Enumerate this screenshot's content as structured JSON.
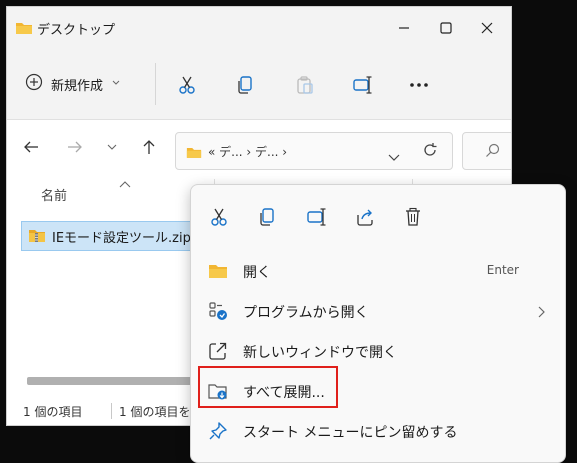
{
  "window": {
    "title": "デスクトップ"
  },
  "toolbar": {
    "new_label": "新規作成"
  },
  "nav": {
    "breadcrumb": "«  デ...  ›  デ...  ›"
  },
  "columns": {
    "name": "名前"
  },
  "files": [
    {
      "name": "IEモード設定ツール.zip"
    }
  ],
  "status": {
    "count": "1 個の項目",
    "selected": "1 個の項目を"
  },
  "context_menu": {
    "items": [
      {
        "label": "開く",
        "shortcut": "Enter",
        "icon": "folder-open-icon"
      },
      {
        "label": "プログラムから開く",
        "icon": "open-with-icon"
      },
      {
        "label": "新しいウィンドウで開く",
        "icon": "new-window-icon"
      },
      {
        "label": "すべて展開...",
        "icon": "extract-all-icon"
      },
      {
        "label": "スタート メニューにピン留めする",
        "icon": "pin-icon"
      }
    ]
  },
  "colors": {
    "accent": "#1a73c8",
    "highlight_box": "#e0201b",
    "folder": "#f2b632",
    "selection": "#cce4f7"
  }
}
